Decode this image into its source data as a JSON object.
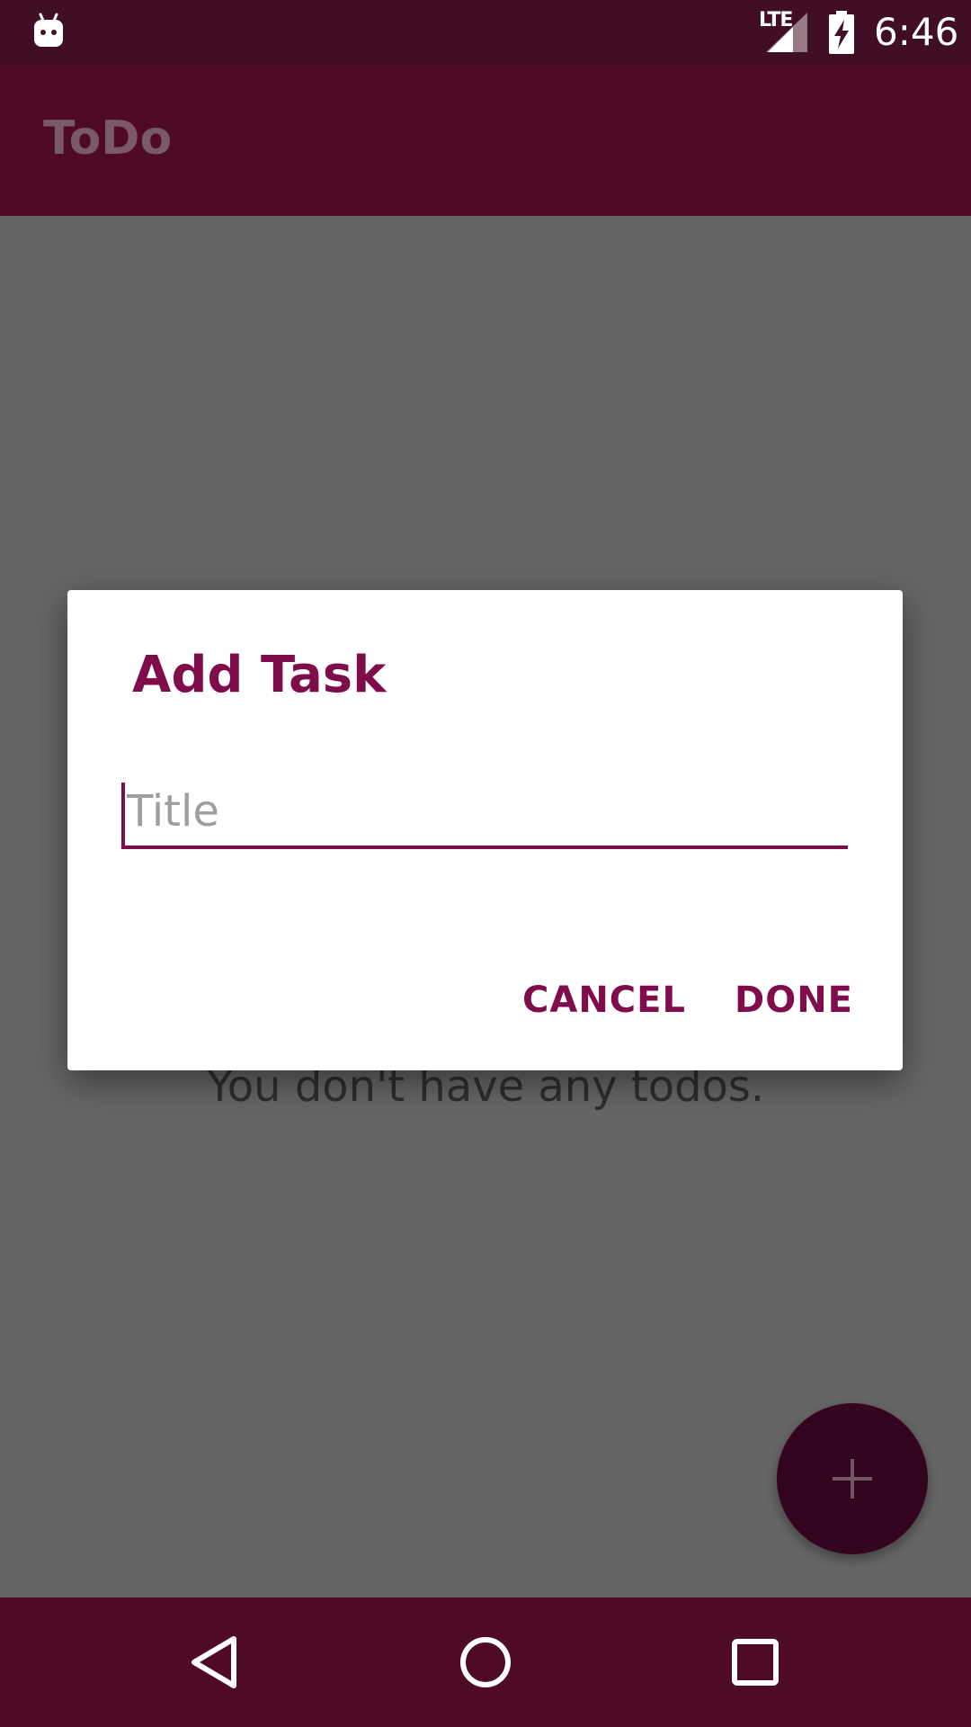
{
  "status_bar": {
    "network": "LTE",
    "time": "6:46"
  },
  "app_bar": {
    "title": "ToDo"
  },
  "content": {
    "empty_message": "You don't have any todos."
  },
  "dialog": {
    "title": "Add Task",
    "input": {
      "value": "",
      "placeholder": "Title"
    },
    "cancel_label": "CANCEL",
    "done_label": "DONE"
  },
  "fab": {
    "icon": "plus-icon"
  },
  "nav_bar": {
    "icons": [
      "back-icon",
      "home-icon",
      "recents-icon"
    ]
  },
  "colors": {
    "primary": "#4f0a25",
    "status_bar": "#410f25",
    "accent": "#7f0c4b",
    "scrim_background": "#666666",
    "fab": "#340520"
  }
}
